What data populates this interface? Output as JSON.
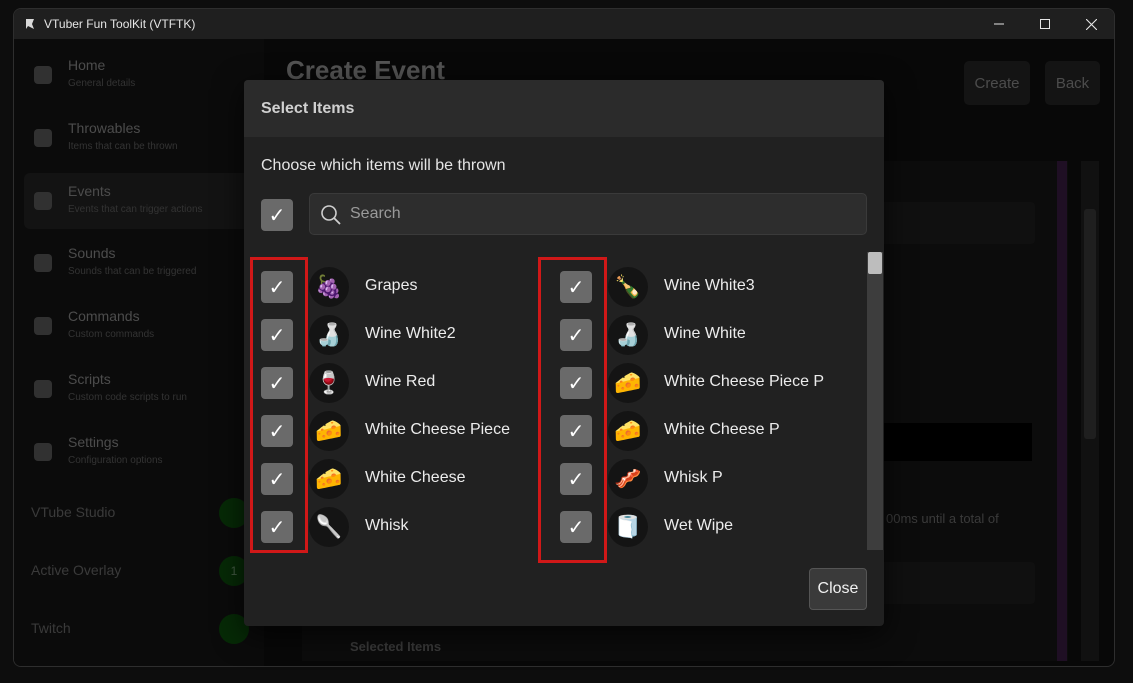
{
  "window": {
    "title": "VTuber Fun ToolKit (VTFTK)",
    "minimize_icon": "minimize-icon",
    "maximize_icon": "maximize-icon",
    "close_icon": "close-icon"
  },
  "sidebar": {
    "items": [
      {
        "title": "Home",
        "subtitle": "General details",
        "icon": "home-icon"
      },
      {
        "title": "Throwables",
        "subtitle": "Items that can be thrown",
        "icon": "throwables-icon"
      },
      {
        "title": "Events",
        "subtitle": "Events that can trigger actions",
        "icon": "events-icon"
      },
      {
        "title": "Sounds",
        "subtitle": "Sounds that can be triggered",
        "icon": "headphones-icon"
      },
      {
        "title": "Commands",
        "subtitle": "Custom commands",
        "icon": "commands-icon"
      },
      {
        "title": "Scripts",
        "subtitle": "Custom code scripts to run",
        "icon": "scripts-icon"
      },
      {
        "title": "Settings",
        "subtitle": "Configuration options",
        "icon": "gear-icon"
      }
    ],
    "status": [
      {
        "label": "VTube Studio",
        "badge": ""
      },
      {
        "label": "Active Overlay",
        "badge": "1"
      },
      {
        "label": "Twitch",
        "badge": ""
      }
    ],
    "active_index": 2
  },
  "main": {
    "title": "Create Event",
    "create_label": "Create",
    "back_label": "Back",
    "bg_text": "00ms until a total of",
    "bg_section": "Selected Items"
  },
  "dialog": {
    "title": "Select Items",
    "subtitle": "Choose which items will be thrown",
    "search_placeholder": "Search",
    "close_label": "Close",
    "check_glyph": "✓",
    "left_items": [
      {
        "label": "Grapes",
        "icon": "🍇",
        "checked": true
      },
      {
        "label": "Wine White2",
        "icon": "🍶",
        "checked": true
      },
      {
        "label": "Wine Red",
        "icon": "🍷",
        "checked": true
      },
      {
        "label": "White Cheese Piece",
        "icon": "🧀",
        "checked": true
      },
      {
        "label": "White Cheese",
        "icon": "🧀",
        "checked": true
      },
      {
        "label": "Whisk",
        "icon": "🥄",
        "checked": true
      }
    ],
    "right_items": [
      {
        "label": "Wine White3",
        "icon": "🍾",
        "checked": true
      },
      {
        "label": "Wine White",
        "icon": "🍶",
        "checked": true
      },
      {
        "label": "White Cheese Piece P",
        "icon": "🧀",
        "checked": true
      },
      {
        "label": "White Cheese P",
        "icon": "🧀",
        "checked": true
      },
      {
        "label": "Whisk P",
        "icon": "🥓",
        "checked": true
      },
      {
        "label": "Wet Wipe",
        "icon": "🧻",
        "checked": true
      }
    ]
  },
  "colors": {
    "highlight_border": "#d01818",
    "checkbox": "#6a6a6a",
    "dialog_bg": "#212121"
  }
}
